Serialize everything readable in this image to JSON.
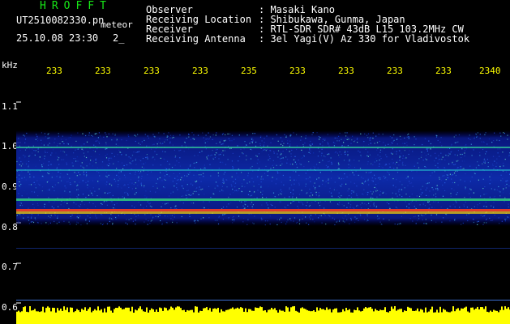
{
  "header": {
    "title": "HROFFT",
    "filename": "UT2510082330.pn",
    "meteor_label": "meteor",
    "datetime": "25.10.08 23:30",
    "count": "2_"
  },
  "info": [
    {
      "key": "Observer",
      "value": ": Masaki Kano"
    },
    {
      "key": "Receiving Location",
      "value": ": Shibukawa, Gunma, Japan"
    },
    {
      "key": "Receiver",
      "value": ": RTL-SDR SDR# 43dB L15 103.2MHz CW"
    },
    {
      "key": "Receiving Antenna",
      "value": ": 3el Yagi(V) Az 330 for Vladivostok"
    }
  ],
  "axis": {
    "unit": "kHz",
    "y_ticks": [
      "1.1",
      "1.0",
      "0.9",
      "0.8",
      "0.7",
      "0.6"
    ],
    "x_ticks": [
      "233",
      "233",
      "233",
      "233",
      "235",
      "233",
      "233",
      "233",
      "233",
      "2340"
    ]
  },
  "colors": {
    "title": "#17e817",
    "tick": "#ffff00",
    "text": "#ffffff",
    "background": "#000000"
  }
}
